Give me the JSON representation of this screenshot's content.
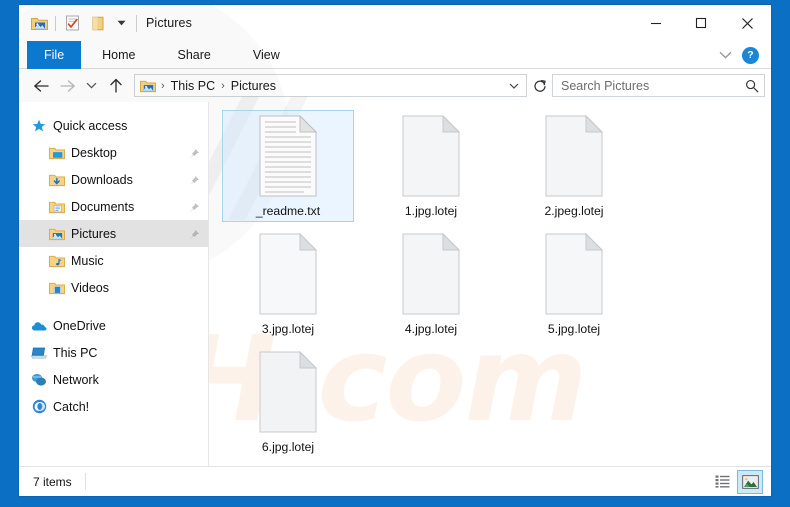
{
  "window": {
    "title": "Pictures",
    "controls": {
      "minimize": "minimize-icon",
      "maximize": "maximize-icon",
      "close": "close-icon"
    }
  },
  "quick_access_toolbar": {
    "items": [
      {
        "name": "explorer-folder-icon",
        "label": ""
      },
      {
        "name": "properties-icon",
        "label": ""
      },
      {
        "name": "new-folder-icon",
        "label": ""
      }
    ],
    "customize_chevron": "▾"
  },
  "ribbon": {
    "tabs": [
      {
        "label": "File",
        "active": true
      },
      {
        "label": "Home",
        "active": false
      },
      {
        "label": "Share",
        "active": false
      },
      {
        "label": "View",
        "active": false
      }
    ],
    "collapse_chevron": "⌄",
    "help_label": "?"
  },
  "navigation": {
    "back": "back-arrow-icon",
    "forward": "forward-arrow-icon",
    "recent": "recent-locations-chevron",
    "up": "up-arrow-icon",
    "breadcrumb": [
      "This PC",
      "Pictures"
    ],
    "breadcrumb_separator": "›",
    "dropdown_chevron": "⌄",
    "refresh": "refresh-icon"
  },
  "search": {
    "placeholder": "Search Pictures",
    "value": "",
    "icon": "search-icon"
  },
  "sidebar": {
    "items": [
      {
        "label": "Quick access",
        "icon": "star-icon",
        "level": 0,
        "selected": false,
        "pinned": false
      },
      {
        "label": "Desktop",
        "icon": "desktop-folder-icon",
        "level": 1,
        "selected": false,
        "pinned": true
      },
      {
        "label": "Downloads",
        "icon": "downloads-folder-icon",
        "level": 1,
        "selected": false,
        "pinned": true
      },
      {
        "label": "Documents",
        "icon": "documents-folder-icon",
        "level": 1,
        "selected": false,
        "pinned": true
      },
      {
        "label": "Pictures",
        "icon": "pictures-folder-icon",
        "level": 1,
        "selected": true,
        "pinned": true
      },
      {
        "label": "Music",
        "icon": "music-folder-icon",
        "level": 1,
        "selected": false,
        "pinned": false
      },
      {
        "label": "Videos",
        "icon": "videos-folder-icon",
        "level": 1,
        "selected": false,
        "pinned": false
      },
      {
        "label": "OneDrive",
        "icon": "onedrive-cloud-icon",
        "level": 0,
        "selected": false,
        "pinned": false
      },
      {
        "label": "This PC",
        "icon": "this-pc-icon",
        "level": 0,
        "selected": false,
        "pinned": false
      },
      {
        "label": "Network",
        "icon": "network-icon",
        "level": 0,
        "selected": false,
        "pinned": false
      },
      {
        "label": "Catch!",
        "icon": "catch-icon",
        "level": 0,
        "selected": false,
        "pinned": false
      }
    ]
  },
  "files": [
    {
      "name": "_readme.txt",
      "type": "text",
      "selected": true
    },
    {
      "name": "1.jpg.lotej",
      "type": "blank",
      "selected": false
    },
    {
      "name": "2.jpeg.lotej",
      "type": "blank",
      "selected": false
    },
    {
      "name": "3.jpg.lotej",
      "type": "blank",
      "selected": false
    },
    {
      "name": "4.jpg.lotej",
      "type": "blank",
      "selected": false
    },
    {
      "name": "5.jpg.lotej",
      "type": "blank",
      "selected": false
    },
    {
      "name": "6.jpg.lotej",
      "type": "blank",
      "selected": false
    }
  ],
  "status": {
    "item_count": "7 items",
    "view_buttons": [
      {
        "name": "details-view-button",
        "active": false
      },
      {
        "name": "large-icons-view-button",
        "active": true
      }
    ]
  },
  "watermark": {
    "gray_text": "∕∕",
    "orange_text": "ISH.com"
  },
  "colors": {
    "desktop_blue": "#0b6fc4",
    "accent_blue": "#0d7cd4",
    "selection_gray": "#e2e2e2",
    "selection_blue": "#cde8f7"
  }
}
